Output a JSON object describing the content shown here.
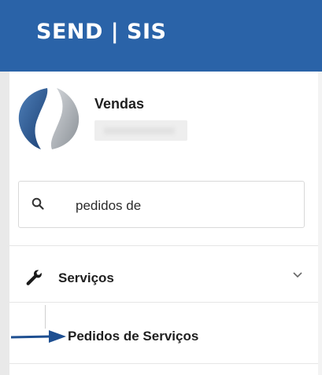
{
  "header": {
    "brand": "SEND | SIS",
    "color": "#2a63a8"
  },
  "user": {
    "name": "Vendas"
  },
  "search": {
    "value": "pedidos de",
    "icon": "search-icon"
  },
  "menu": {
    "items": [
      {
        "label": "Serviços",
        "icon": "wrench-icon",
        "expanded": true,
        "children": [
          {
            "label": "Pedidos de Serviços"
          }
        ]
      }
    ]
  }
}
